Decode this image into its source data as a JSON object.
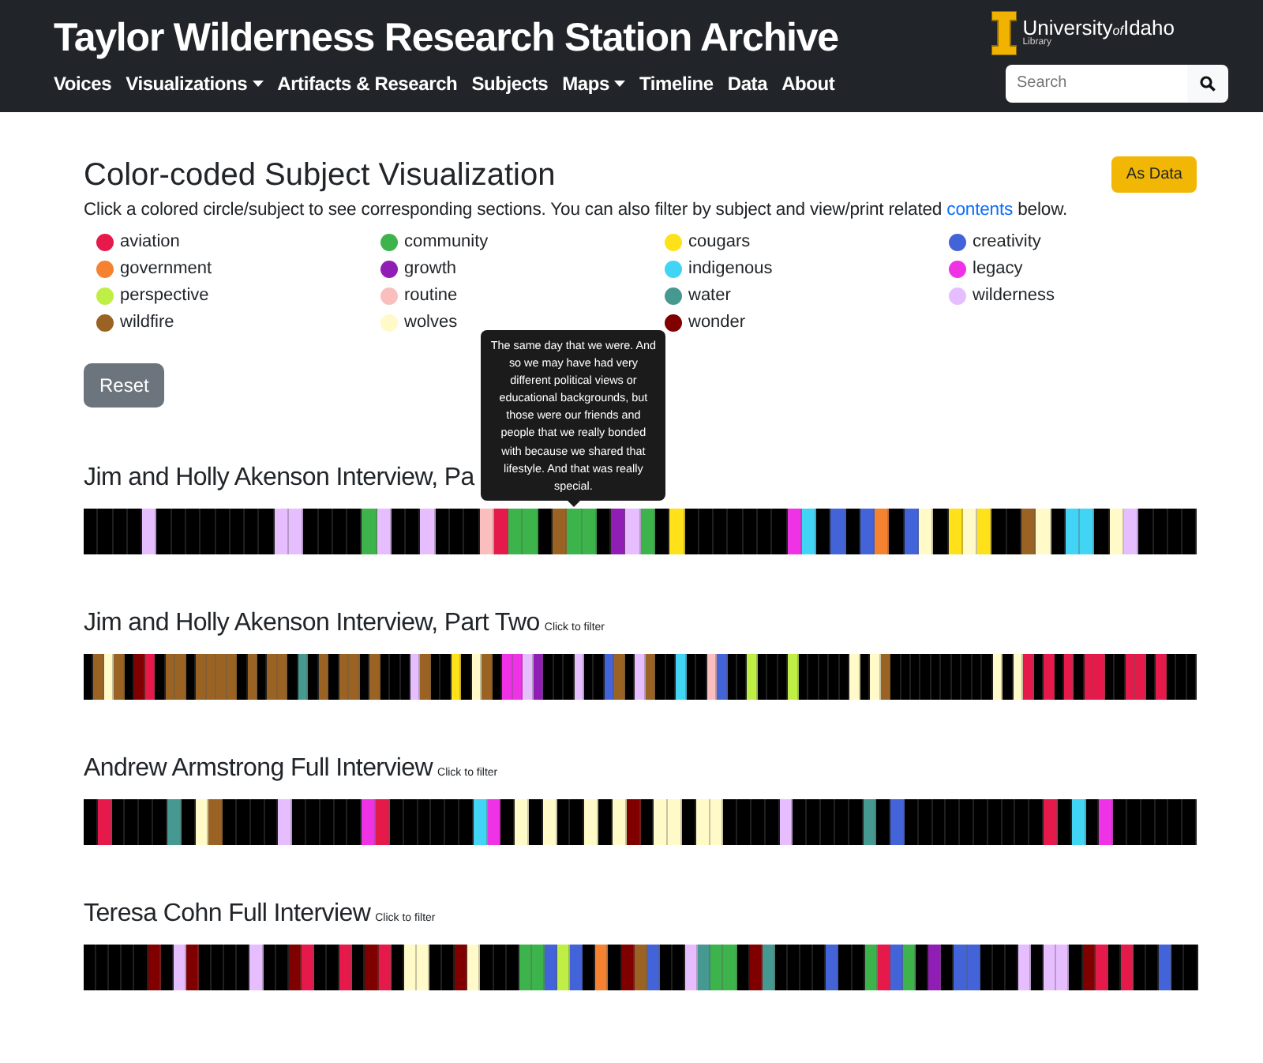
{
  "header": {
    "title": "Taylor Wilderness Research Station Archive",
    "nav": [
      {
        "label": "Voices",
        "dropdown": false
      },
      {
        "label": "Visualizations",
        "dropdown": true
      },
      {
        "label": "Artifacts & Research",
        "dropdown": false
      },
      {
        "label": "Subjects",
        "dropdown": false
      },
      {
        "label": "Maps",
        "dropdown": true
      },
      {
        "label": "Timeline",
        "dropdown": false
      },
      {
        "label": "Data",
        "dropdown": false
      },
      {
        "label": "About",
        "dropdown": false
      }
    ],
    "logo": {
      "name": "University",
      "of": "of",
      "name2": "Idaho",
      "sub": "Library"
    },
    "search": {
      "placeholder": "Search"
    }
  },
  "heading": "Color-coded Subject Visualization",
  "as_data_button": "As Data",
  "intro": {
    "before": "Click a colored circle/subject to see corresponding sections. You can also filter by subject and view/print related",
    "link": "contents",
    "after": "below."
  },
  "subjects": [
    {
      "label": "aviation",
      "color": "#e6194b"
    },
    {
      "label": "community",
      "color": "#3cb44b"
    },
    {
      "label": "cougars",
      "color": "#ffe119"
    },
    {
      "label": "creativity",
      "color": "#4363d8"
    },
    {
      "label": "government",
      "color": "#f58231"
    },
    {
      "label": "growth",
      "color": "#911eb4"
    },
    {
      "label": "indigenous",
      "color": "#42d4f4"
    },
    {
      "label": "legacy",
      "color": "#f032e6"
    },
    {
      "label": "perspective",
      "color": "#bfef45"
    },
    {
      "label": "routine",
      "color": "#fabebe"
    },
    {
      "label": "water",
      "color": "#469990"
    },
    {
      "label": "wilderness",
      "color": "#e6beff"
    },
    {
      "label": "wildfire",
      "color": "#9a6324"
    },
    {
      "label": "wolves",
      "color": "#fffac8"
    },
    {
      "label": "wonder",
      "color": "#800000"
    }
  ],
  "reset_button": "Reset",
  "interviews": [
    {
      "title": "Jim and Holly Akenson Interview, Pa",
      "tooltip": "The same day that we were. And so we may have had very different political views or educational backgrounds, but those were our friends and people that we really bonded with because we shared that lifestyle. And that was really special.",
      "segments": [
        {
          "color": "#000000"
        },
        {
          "color": "#000000"
        },
        {
          "color": "#000000"
        },
        {
          "color": "#000000"
        },
        {
          "color": "#e6beff"
        },
        {
          "color": "#000000"
        },
        {
          "color": "#000000"
        },
        {
          "color": "#000000"
        },
        {
          "color": "#000000"
        },
        {
          "color": "#000000"
        },
        {
          "color": "#000000"
        },
        {
          "color": "#000000"
        },
        {
          "color": "#000000"
        },
        {
          "color": "#e6beff"
        },
        {
          "color": "#e6beff"
        },
        {
          "color": "#000000"
        },
        {
          "color": "#000000"
        },
        {
          "color": "#000000"
        },
        {
          "color": "#000000"
        },
        {
          "color": "#3cb44b"
        },
        {
          "color": "#e6beff"
        },
        {
          "color": "#000000"
        },
        {
          "color": "#000000"
        },
        {
          "color": "#e6beff"
        },
        {
          "color": "#000000"
        },
        {
          "color": "#000000"
        },
        {
          "color": "#000000"
        },
        {
          "color": "#fabebe"
        },
        {
          "color": "#e6194b"
        },
        {
          "color": "#3cb44b"
        },
        {
          "color": "#3cb44b"
        },
        {
          "color": "#000000"
        },
        {
          "color": "#9a6324"
        },
        {
          "color": "#3cb44b"
        },
        {
          "color": "#3cb44b"
        },
        {
          "color": "#000000"
        },
        {
          "color": "#911eb4"
        },
        {
          "color": "#e6beff"
        },
        {
          "color": "#3cb44b"
        },
        {
          "color": "#000000"
        },
        {
          "color": "#ffe119"
        },
        {
          "color": "#000000"
        },
        {
          "color": "#000000"
        },
        {
          "color": "#000000"
        },
        {
          "color": "#000000"
        },
        {
          "color": "#000000"
        },
        {
          "color": "#000000"
        },
        {
          "color": "#000000"
        },
        {
          "color": "#f032e6"
        },
        {
          "color": "#42d4f4"
        },
        {
          "color": "#000000"
        },
        {
          "color": "#4363d8"
        },
        {
          "color": "#000000"
        },
        {
          "color": "#4363d8"
        },
        {
          "color": "#f58231"
        },
        {
          "color": "#000000"
        },
        {
          "color": "#4363d8"
        },
        {
          "color": "#fffac8"
        },
        {
          "color": "#000000"
        },
        {
          "color": "#ffe119"
        },
        {
          "color": "#fffac8"
        },
        {
          "color": "#ffe119"
        },
        {
          "color": "#000000"
        },
        {
          "color": "#000000"
        },
        {
          "color": "#9a6324"
        },
        {
          "color": "#fffac8"
        },
        {
          "color": "#000000"
        },
        {
          "color": "#42d4f4"
        },
        {
          "color": "#42d4f4"
        },
        {
          "color": "#000000"
        },
        {
          "color": "#fffac8"
        },
        {
          "color": "#e6beff"
        },
        {
          "color": "#000000"
        },
        {
          "color": "#000000"
        },
        {
          "color": "#000000"
        },
        {
          "color": "#000000"
        }
      ]
    },
    {
      "title": "Jim and Holly Akenson Interview, Part Two",
      "hint": "Click to filter",
      "segments": [
        {
          "color": "#000000"
        },
        {
          "color": "#9a6324"
        },
        {
          "color": "#fffac8"
        },
        {
          "color": "#9a6324"
        },
        {
          "color": "#000000"
        },
        {
          "color": "#800000"
        },
        {
          "color": "#e6194b"
        },
        {
          "color": "#000000"
        },
        {
          "color": "#9a6324"
        },
        {
          "color": "#9a6324"
        },
        {
          "color": "#000000"
        },
        {
          "color": "#9a6324"
        },
        {
          "color": "#9a6324"
        },
        {
          "color": "#9a6324"
        },
        {
          "color": "#9a6324"
        },
        {
          "color": "#000000"
        },
        {
          "color": "#9a6324"
        },
        {
          "color": "#000000"
        },
        {
          "color": "#9a6324"
        },
        {
          "color": "#9a6324"
        },
        {
          "color": "#000000"
        },
        {
          "color": "#469990"
        },
        {
          "color": "#000000"
        },
        {
          "color": "#9a6324"
        },
        {
          "color": "#000000"
        },
        {
          "color": "#9a6324"
        },
        {
          "color": "#9a6324"
        },
        {
          "color": "#000000"
        },
        {
          "color": "#9a6324"
        },
        {
          "color": "#000000"
        },
        {
          "color": "#000000"
        },
        {
          "color": "#000000"
        },
        {
          "color": "#e6beff"
        },
        {
          "color": "#9a6324"
        },
        {
          "color": "#000000"
        },
        {
          "color": "#000000"
        },
        {
          "color": "#ffe119"
        },
        {
          "color": "#000000"
        },
        {
          "color": "#fffac8"
        },
        {
          "color": "#9a6324"
        },
        {
          "color": "#000000"
        },
        {
          "color": "#f032e6"
        },
        {
          "color": "#f032e6"
        },
        {
          "color": "#e6beff"
        },
        {
          "color": "#911eb4"
        },
        {
          "color": "#000000"
        },
        {
          "color": "#000000"
        },
        {
          "color": "#000000"
        },
        {
          "color": "#e6beff"
        },
        {
          "color": "#000000"
        },
        {
          "color": "#000000"
        },
        {
          "color": "#4363d8"
        },
        {
          "color": "#9a6324"
        },
        {
          "color": "#000000"
        },
        {
          "color": "#e6beff"
        },
        {
          "color": "#9a6324"
        },
        {
          "color": "#000000"
        },
        {
          "color": "#000000"
        },
        {
          "color": "#42d4f4"
        },
        {
          "color": "#000000"
        },
        {
          "color": "#000000"
        },
        {
          "color": "#fabebe"
        },
        {
          "color": "#4363d8"
        },
        {
          "color": "#000000"
        },
        {
          "color": "#000000"
        },
        {
          "color": "#bfef45"
        },
        {
          "color": "#000000"
        },
        {
          "color": "#000000"
        },
        {
          "color": "#000000"
        },
        {
          "color": "#bfef45"
        },
        {
          "color": "#000000"
        },
        {
          "color": "#000000"
        },
        {
          "color": "#000000"
        },
        {
          "color": "#000000"
        },
        {
          "color": "#000000"
        },
        {
          "color": "#fffac8"
        },
        {
          "color": "#000000"
        },
        {
          "color": "#fffac8"
        },
        {
          "color": "#9a6324"
        },
        {
          "color": "#000000"
        },
        {
          "color": "#000000"
        },
        {
          "color": "#000000"
        },
        {
          "color": "#000000"
        },
        {
          "color": "#000000"
        },
        {
          "color": "#000000"
        },
        {
          "color": "#000000"
        },
        {
          "color": "#000000"
        },
        {
          "color": "#000000"
        },
        {
          "color": "#000000"
        },
        {
          "color": "#fffac8"
        },
        {
          "color": "#000000"
        },
        {
          "color": "#fffac8"
        },
        {
          "color": "#e6194b"
        },
        {
          "color": "#000000"
        },
        {
          "color": "#e6194b"
        },
        {
          "color": "#000000"
        },
        {
          "color": "#e6194b"
        },
        {
          "color": "#000000"
        },
        {
          "color": "#e6194b"
        },
        {
          "color": "#e6194b"
        },
        {
          "color": "#000000"
        },
        {
          "color": "#000000"
        },
        {
          "color": "#e6194b"
        },
        {
          "color": "#e6194b"
        },
        {
          "color": "#000000"
        },
        {
          "color": "#e6194b"
        },
        {
          "color": "#000000"
        },
        {
          "color": "#000000"
        },
        {
          "color": "#000000"
        }
      ]
    },
    {
      "title": "Andrew Armstrong Full Interview",
      "hint": "Click to filter",
      "segments": [
        {
          "color": "#000000"
        },
        {
          "color": "#e6194b"
        },
        {
          "color": "#000000"
        },
        {
          "color": "#000000"
        },
        {
          "color": "#000000"
        },
        {
          "color": "#000000"
        },
        {
          "color": "#469990"
        },
        {
          "color": "#000000"
        },
        {
          "color": "#fffac8"
        },
        {
          "color": "#9a6324"
        },
        {
          "color": "#000000"
        },
        {
          "color": "#000000"
        },
        {
          "color": "#000000"
        },
        {
          "color": "#000000"
        },
        {
          "color": "#e6beff"
        },
        {
          "color": "#000000"
        },
        {
          "color": "#000000"
        },
        {
          "color": "#000000"
        },
        {
          "color": "#000000"
        },
        {
          "color": "#000000"
        },
        {
          "color": "#f032e6"
        },
        {
          "color": "#e6194b"
        },
        {
          "color": "#000000"
        },
        {
          "color": "#000000"
        },
        {
          "color": "#000000"
        },
        {
          "color": "#000000"
        },
        {
          "color": "#000000"
        },
        {
          "color": "#000000"
        },
        {
          "color": "#42d4f4"
        },
        {
          "color": "#f032e6"
        },
        {
          "color": "#000000"
        },
        {
          "color": "#fffac8"
        },
        {
          "color": "#000000"
        },
        {
          "color": "#fffac8"
        },
        {
          "color": "#000000"
        },
        {
          "color": "#000000"
        },
        {
          "color": "#fffac8"
        },
        {
          "color": "#000000"
        },
        {
          "color": "#fffac8"
        },
        {
          "color": "#800000"
        },
        {
          "color": "#000000"
        },
        {
          "color": "#fffac8"
        },
        {
          "color": "#fffac8"
        },
        {
          "color": "#000000"
        },
        {
          "color": "#fffac8"
        },
        {
          "color": "#fffac8"
        },
        {
          "color": "#000000"
        },
        {
          "color": "#000000"
        },
        {
          "color": "#000000"
        },
        {
          "color": "#000000"
        },
        {
          "color": "#e6beff"
        },
        {
          "color": "#000000"
        },
        {
          "color": "#000000"
        },
        {
          "color": "#000000"
        },
        {
          "color": "#000000"
        },
        {
          "color": "#000000"
        },
        {
          "color": "#469990"
        },
        {
          "color": "#000000"
        },
        {
          "color": "#4363d8"
        },
        {
          "color": "#000000"
        },
        {
          "color": "#000000"
        },
        {
          "color": "#000000"
        },
        {
          "color": "#000000"
        },
        {
          "color": "#000000"
        },
        {
          "color": "#000000"
        },
        {
          "color": "#000000"
        },
        {
          "color": "#000000"
        },
        {
          "color": "#000000"
        },
        {
          "color": "#000000"
        },
        {
          "color": "#e6194b"
        },
        {
          "color": "#000000"
        },
        {
          "color": "#42d4f4"
        },
        {
          "color": "#000000"
        },
        {
          "color": "#f032e6"
        },
        {
          "color": "#000000"
        },
        {
          "color": "#000000"
        },
        {
          "color": "#000000"
        },
        {
          "color": "#000000"
        },
        {
          "color": "#000000"
        },
        {
          "color": "#000000"
        }
      ]
    },
    {
      "title": "Teresa Cohn Full Interview",
      "hint": "Click to filter",
      "segments": [
        {
          "color": "#000000"
        },
        {
          "color": "#000000"
        },
        {
          "color": "#000000"
        },
        {
          "color": "#000000"
        },
        {
          "color": "#000000"
        },
        {
          "color": "#800000"
        },
        {
          "color": "#000000"
        },
        {
          "color": "#e6beff"
        },
        {
          "color": "#800000"
        },
        {
          "color": "#000000"
        },
        {
          "color": "#000000"
        },
        {
          "color": "#000000"
        },
        {
          "color": "#000000"
        },
        {
          "color": "#e6beff"
        },
        {
          "color": "#000000"
        },
        {
          "color": "#000000"
        },
        {
          "color": "#800000"
        },
        {
          "color": "#e6194b"
        },
        {
          "color": "#000000"
        },
        {
          "color": "#000000"
        },
        {
          "color": "#e6194b"
        },
        {
          "color": "#000000"
        },
        {
          "color": "#800000"
        },
        {
          "color": "#e6194b"
        },
        {
          "color": "#000000"
        },
        {
          "color": "#fffac8"
        },
        {
          "color": "#fffac8"
        },
        {
          "color": "#000000"
        },
        {
          "color": "#000000"
        },
        {
          "color": "#800000"
        },
        {
          "color": "#fffac8"
        },
        {
          "color": "#000000"
        },
        {
          "color": "#000000"
        },
        {
          "color": "#000000"
        },
        {
          "color": "#3cb44b"
        },
        {
          "color": "#3cb44b"
        },
        {
          "color": "#4363d8"
        },
        {
          "color": "#bfef45"
        },
        {
          "color": "#4363d8"
        },
        {
          "color": "#000000"
        },
        {
          "color": "#f58231"
        },
        {
          "color": "#000000"
        },
        {
          "color": "#800000"
        },
        {
          "color": "#9a6324"
        },
        {
          "color": "#4363d8"
        },
        {
          "color": "#000000"
        },
        {
          "color": "#000000"
        },
        {
          "color": "#e6beff"
        },
        {
          "color": "#469990"
        },
        {
          "color": "#3cb44b"
        },
        {
          "color": "#3cb44b"
        },
        {
          "color": "#000000"
        },
        {
          "color": "#800000"
        },
        {
          "color": "#469990"
        },
        {
          "color": "#000000"
        },
        {
          "color": "#000000"
        },
        {
          "color": "#000000"
        },
        {
          "color": "#000000"
        },
        {
          "color": "#4363d8"
        },
        {
          "color": "#000000"
        },
        {
          "color": "#000000"
        },
        {
          "color": "#3cb44b"
        },
        {
          "color": "#e6194b"
        },
        {
          "color": "#4363d8"
        },
        {
          "color": "#3cb44b"
        },
        {
          "color": "#000000"
        },
        {
          "color": "#911eb4"
        },
        {
          "color": "#000000"
        },
        {
          "color": "#4363d8"
        },
        {
          "color": "#4363d8"
        },
        {
          "color": "#000000"
        },
        {
          "color": "#000000"
        },
        {
          "color": "#000000"
        },
        {
          "color": "#e6beff"
        },
        {
          "color": "#000000"
        },
        {
          "color": "#e6beff"
        },
        {
          "color": "#e6beff"
        },
        {
          "color": "#000000"
        },
        {
          "color": "#800000"
        },
        {
          "color": "#e6194b"
        },
        {
          "color": "#000000"
        },
        {
          "color": "#e6194b"
        },
        {
          "color": "#000000"
        },
        {
          "color": "#000000"
        },
        {
          "color": "#4363d8"
        },
        {
          "color": "#000000"
        },
        {
          "color": "#000000"
        }
      ]
    }
  ]
}
